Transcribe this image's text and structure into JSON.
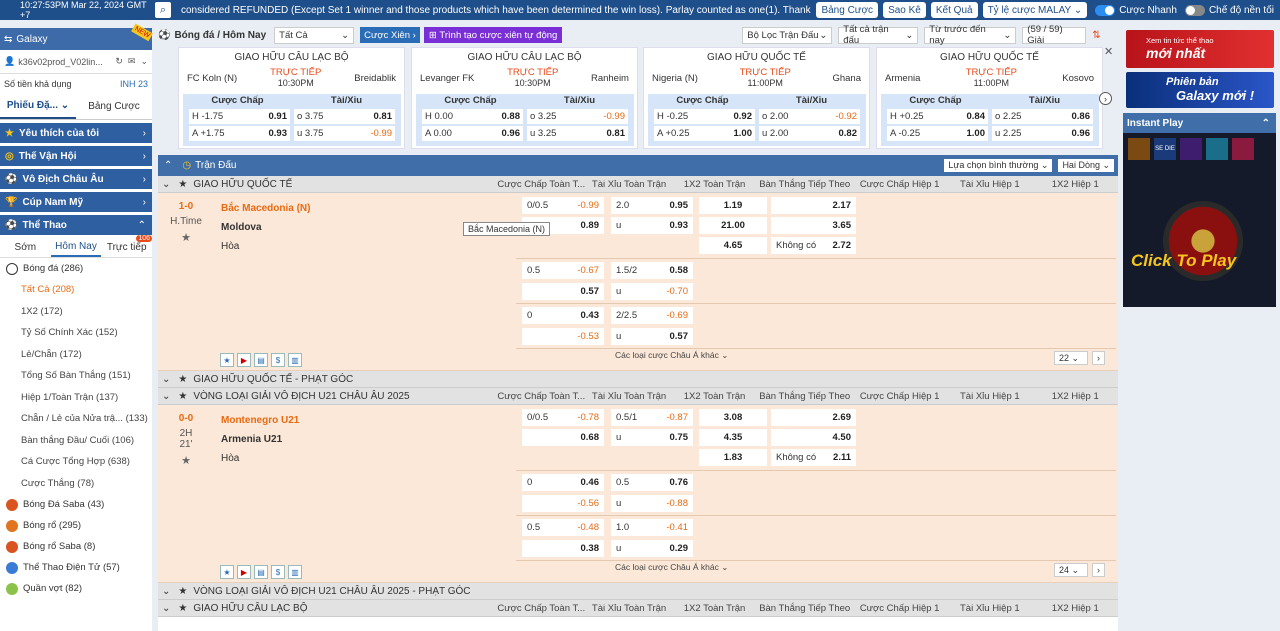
{
  "topbar": {
    "time": "10:27:53PM Mar 22, 2024 GMT +7",
    "marquee": "considered REFUNDED (Except Set 1 winner and those products which have been determined the win loss). Parlay counted as one(1). Thank you!",
    "buttons": [
      "Bảng Cược",
      "Sao Kê",
      "Kết Quả",
      "Tỷ lệ cược MALAY ⌄"
    ],
    "toggle1": "Cược Nhanh",
    "toggle2": "Chế độ nền tối"
  },
  "sidebar": {
    "brand": "Galaxy",
    "new": "NEW",
    "account": "k36v02prod_V02lin...",
    "balance_label": "Số tiền khả dụng",
    "balance_value": "INH 23",
    "tabs": [
      "Phiếu Đặ... ⌄",
      "Bảng Cược"
    ],
    "cats": [
      "Yêu thích của tôi",
      "Thế Vận Hội",
      "Vô Địch Châu Âu",
      "Cúp Nam Mỹ",
      "Thể Thao"
    ],
    "subtabs": [
      "Sớm",
      "Hôm Nay",
      "Trực tiếp"
    ],
    "live_badge": "106",
    "football": "Bóng đá",
    "football_count": "(286)",
    "bet_items": [
      {
        "label": "Tất Cả",
        "count": "(208)"
      },
      {
        "label": "1X2",
        "count": "(172)"
      },
      {
        "label": "Tỷ Số Chính Xác",
        "count": "(152)"
      },
      {
        "label": "Lẻ/Chẵn",
        "count": "(172)"
      },
      {
        "label": "Tổng Số Bàn Thắng",
        "count": "(151)"
      },
      {
        "label": "Hiệp 1/Toàn Trận",
        "count": "(137)"
      },
      {
        "label": "Chẵn / Lẻ của Nửa trậ...",
        "count": "(133)"
      },
      {
        "label": "Bàn thắng Đầu/ Cuối",
        "count": "(106)"
      },
      {
        "label": "Cá Cược Tổng Hợp",
        "count": "(638)"
      },
      {
        "label": "Cược Thắng",
        "count": "(78)"
      }
    ],
    "sports": [
      {
        "label": "Bóng Đá Saba",
        "count": "(43)"
      },
      {
        "label": "Bóng rổ",
        "count": "(295)"
      },
      {
        "label": "Bóng rổ Saba",
        "count": "(8)"
      },
      {
        "label": "Thể Thao Điện Tử",
        "count": "(57)"
      },
      {
        "label": "Quần vợt",
        "count": "(82)"
      }
    ]
  },
  "header": {
    "title": "Bóng đá / Hôm Nay",
    "filter": "Tất Cả",
    "parlay": "Cược Xiên",
    "create": "Trình tạo cược xiên tự động",
    "league_filter": "Bộ Lọc Trận Đấu",
    "all_matches": "Tất cả trận đấu",
    "sort": "Từ trước đến nay",
    "count": "(59 / 59) Giải"
  },
  "cards": [
    {
      "league": "GIAO HỮU CÂU LẠC BỘ",
      "home": "FC Koln (N)",
      "away": "Breidablik",
      "live": "TRỰC TIẾP",
      "time": "10:30PM",
      "h1": "H -1.75",
      "h1o": "0.91",
      "a1": "A +1.75",
      "a1o": "0.93",
      "o1": "o 3.75",
      "o1o": "0.81",
      "u1": "u 3.75",
      "u1o": "-0.99"
    },
    {
      "league": "GIAO HỮU CÂU LẠC BỘ",
      "home": "Levanger FK",
      "away": "Ranheim",
      "live": "TRỰC TIẾP",
      "time": "10:30PM",
      "h1": "H 0.00",
      "h1o": "0.88",
      "a1": "A 0.00",
      "a1o": "0.96",
      "o1": "o 3.25",
      "o1o": "-0.99",
      "u1": "u 3.25",
      "u1o": "0.81"
    },
    {
      "league": "GIAO HỮU QUỐC TẾ",
      "home": "Nigeria (N)",
      "away": "Ghana",
      "live": "TRỰC TIẾP",
      "time": "11:00PM",
      "h1": "H -0.25",
      "h1o": "0.92",
      "a1": "A +0.25",
      "a1o": "1.00",
      "o1": "o 2.00",
      "o1o": "-0.92",
      "u1": "u 2.00",
      "u1o": "0.82"
    },
    {
      "league": "GIAO HỮU QUỐC TẾ",
      "home": "Armenia",
      "away": "Kosovo",
      "live": "TRỰC TIẾP",
      "time": "11:00PM",
      "h1": "H +0.25",
      "h1o": "0.84",
      "a1": "A -0.25",
      "a1o": "1.00",
      "o1": "o 2.25",
      "o1o": "0.86",
      "u1": "u 2.25",
      "u1o": "0.96"
    }
  ],
  "card_headers": [
    "Cược Chấp",
    "Tài/Xỉu"
  ],
  "table": {
    "title": "Trận Đấu",
    "view": "Lựa chọn bình thường ⌄",
    "lines": "Hai Dòng ⌄",
    "cols": [
      "Cược Chấp Toàn T...",
      "Tài Xỉu Toàn Trận",
      "1X2 Toàn Trận",
      "Bàn Thắng Tiếp Theo",
      "Cược Chấp Hiệp 1",
      "Tài Xỉu Hiệp 1",
      "1X2 Hiệp 1"
    ],
    "leagues": [
      "GIAO HỮU QUỐC TẾ",
      "GIAO HỮU QUỐC TẾ - PHẠT GÓC",
      "VÒNG LOẠI GIẢI VÔ ĐỊCH U21 CHÂU ÂU 2025",
      "VÒNG LOẠI GIẢI VÔ ĐỊCH U21 CHÂU ÂU 2025 - PHẠT GÓC",
      "GIAO HỮU CÂU LẠC BỘ"
    ],
    "m1": {
      "score": "1-0",
      "period": "H.Time",
      "home": "Bắc Macedonia (N)",
      "away": "Moldova",
      "draw": "Hòa",
      "more": "Các loại cược Châu Á khác ⌄",
      "pager": "22 ⌄",
      "r": [
        [
          "0/0.5",
          "-0.99",
          "2.0",
          "0.95",
          "1.19",
          "2.17"
        ],
        [
          "",
          "0.89",
          "u",
          "0.93",
          "21.00",
          "3.65"
        ],
        [
          "",
          "",
          "",
          "",
          "4.65",
          "Không có",
          "2.72"
        ]
      ],
      "r2": [
        [
          "0.5",
          "-0.67",
          "1.5/2",
          "0.58"
        ],
        [
          "",
          "0.57",
          "u",
          "-0.70"
        ]
      ],
      "r3": [
        [
          "0",
          "0.43",
          "2/2.5",
          "-0.69"
        ],
        [
          "",
          "-0.53",
          "u",
          "0.57"
        ]
      ]
    },
    "m2": {
      "score": "0-0",
      "period": "2H",
      "min": "21'",
      "home": "Montenegro U21",
      "away": "Armenia U21",
      "draw": "Hòa",
      "more": "Các loại cược Châu Á khác ⌄",
      "pager": "24 ⌄",
      "r": [
        [
          "0/0.5",
          "-0.78",
          "0.5/1",
          "-0.87",
          "3.08",
          "2.69"
        ],
        [
          "",
          "0.68",
          "u",
          "0.75",
          "4.35",
          "4.50"
        ],
        [
          "",
          "",
          "",
          "",
          "1.83",
          "Không có",
          "2.11"
        ]
      ],
      "r2": [
        [
          "0",
          "0.46",
          "0.5",
          "0.76"
        ],
        [
          "",
          "-0.56",
          "u",
          "-0.88"
        ]
      ],
      "r3": [
        [
          "0.5",
          "-0.48",
          "1.0",
          "-0.41"
        ],
        [
          "",
          "0.38",
          "u",
          "0.29"
        ]
      ]
    },
    "tooltip": "Bắc Macedonia (N)"
  },
  "right": {
    "ad1_a": "Xem tin tức thể thao",
    "ad1_b": "mới nhất",
    "ad2_a": "Phiên bản",
    "ad2_b": "Galaxy mới !",
    "instant": "Instant Play",
    "click": "Click To Play",
    "se_die": "SE DIE"
  }
}
